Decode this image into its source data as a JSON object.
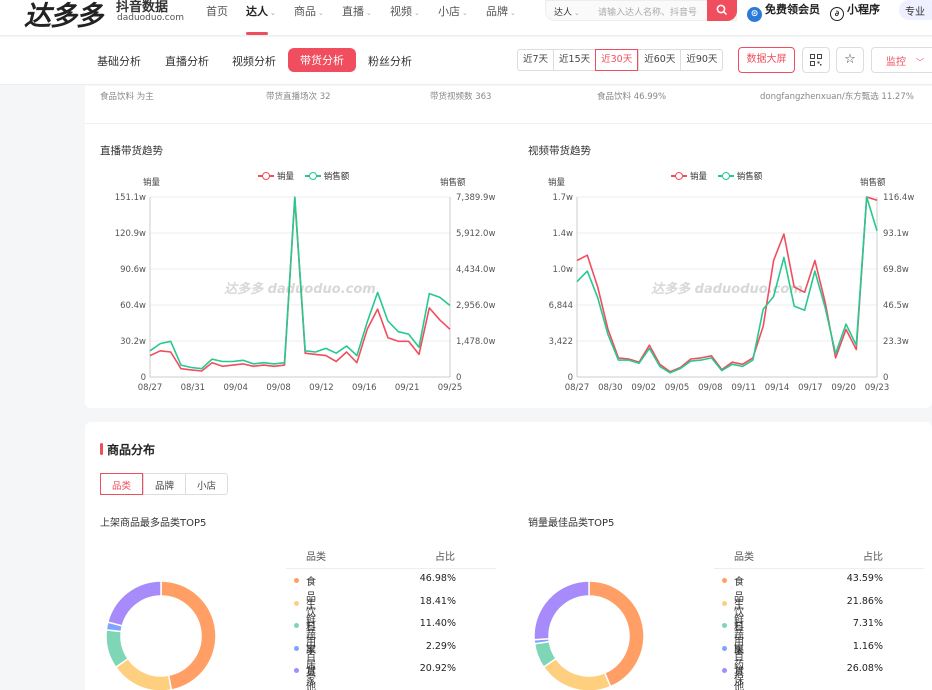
{
  "brand": {
    "logo": "达多多",
    "name": "抖音数据",
    "domain": "daduoduo.com"
  },
  "nav": [
    "首页",
    "达人",
    "商品",
    "直播",
    "视频",
    "小店",
    "品牌"
  ],
  "search": {
    "type": "达人",
    "placeholder": "请输入达人名称、抖音号"
  },
  "header_right": {
    "vip": "免费领会员",
    "mini": "小程序",
    "pro": "专业"
  },
  "tabs": [
    "基础分析",
    "直播分析",
    "视频分析",
    "带货分析",
    "粉丝分析"
  ],
  "active_tab": "带货分析",
  "ranges": [
    "近7天",
    "近15天",
    "近30天",
    "近60天",
    "近90天"
  ],
  "active_range": "近30天",
  "big_screen": "数据大屏",
  "monitor": "监控",
  "info_row": [
    "食品饮料 为主",
    "带货直播场次 32",
    "带货视频数 363",
    "食品饮料 46.99%",
    "dongfangzhenxuan/东方甄选 11.27%"
  ],
  "charts": [
    {
      "title": "直播带货趋势",
      "legend": [
        "销量",
        "销售额"
      ],
      "left_axis_name": "销量",
      "right_axis_name": "销售额",
      "left_ticks": [
        "0",
        "30.2w",
        "60.4w",
        "90.6w",
        "120.9w",
        "151.1w"
      ],
      "right_ticks": [
        "0",
        "1,478.0w",
        "2,956.0w",
        "4,434.0w",
        "5,912.0w",
        "7,389.9w"
      ],
      "x_ticks": [
        "08/27",
        "08/31",
        "09/04",
        "09/08",
        "09/12",
        "09/16",
        "09/21",
        "09/25"
      ]
    },
    {
      "title": "视频带货趋势",
      "legend": [
        "销量",
        "销售额"
      ],
      "left_axis_name": "销量",
      "right_axis_name": "销售额",
      "left_ticks": [
        "0",
        "3,422",
        "6,844",
        "1.0w",
        "1.4w",
        "1.7w"
      ],
      "right_ticks": [
        "0",
        "23.3w",
        "46.5w",
        "69.8w",
        "93.1w",
        "116.4w"
      ],
      "x_ticks": [
        "08/27",
        "08/30",
        "09/02",
        "09/05",
        "09/08",
        "09/11",
        "09/14",
        "09/17",
        "09/20",
        "09/23"
      ]
    }
  ],
  "chart_data": [
    {
      "type": "line",
      "title": "直播带货趋势",
      "xlabel": "",
      "ylabel": "销量",
      "y2label": "销售额",
      "x": [
        "08/27",
        "08/28",
        "08/29",
        "08/30",
        "08/31",
        "09/01",
        "09/02",
        "09/03",
        "09/04",
        "09/05",
        "09/06",
        "09/07",
        "09/08",
        "09/09",
        "09/10",
        "09/11",
        "09/12",
        "09/13",
        "09/14",
        "09/15",
        "09/16",
        "09/17",
        "09/18",
        "09/19",
        "09/20",
        "09/21",
        "09/22",
        "09/23",
        "09/24",
        "09/25"
      ],
      "ylim": [
        0,
        151.1
      ],
      "y2lim": [
        0,
        7389.9
      ],
      "series": [
        {
          "name": "销量",
          "axis": "left",
          "unit": "w",
          "values": [
            18,
            22,
            21,
            7,
            6,
            5,
            12,
            9,
            10,
            11,
            9,
            10,
            9,
            10,
            150,
            20,
            19,
            18,
            13,
            21,
            12,
            40,
            57,
            33,
            30,
            30,
            19,
            58,
            48,
            40
          ]
        },
        {
          "name": "销售额",
          "axis": "left_scaled",
          "unit": "w",
          "values": [
            22,
            28,
            30,
            10,
            8,
            7,
            15,
            13,
            13,
            14,
            11,
            12,
            11,
            12,
            151,
            22,
            21,
            24,
            20,
            26,
            18,
            46,
            71,
            47,
            38,
            36,
            25,
            70,
            67,
            60
          ]
        }
      ]
    },
    {
      "type": "line",
      "title": "视频带货趋势",
      "xlabel": "",
      "ylabel": "销量",
      "y2label": "销售额",
      "x": [
        "08/27",
        "08/28",
        "08/29",
        "08/30",
        "08/31",
        "09/01",
        "09/02",
        "09/03",
        "09/04",
        "09/05",
        "09/06",
        "09/07",
        "09/08",
        "09/09",
        "09/10",
        "09/11",
        "09/12",
        "09/13",
        "09/14",
        "09/15",
        "09/16",
        "09/17",
        "09/18",
        "09/19",
        "09/20",
        "09/21",
        "09/22",
        "09/23",
        "09/24",
        "09/25"
      ],
      "ylim": [
        0,
        1.7
      ],
      "y2lim": [
        0,
        116.4
      ],
      "series": [
        {
          "name": "销量",
          "axis": "left",
          "unit": "w",
          "values": [
            1.1,
            1.15,
            0.85,
            0.45,
            0.18,
            0.17,
            0.14,
            0.3,
            0.12,
            0.05,
            0.09,
            0.17,
            0.18,
            0.2,
            0.07,
            0.14,
            0.12,
            0.18,
            0.48,
            1.1,
            1.35,
            0.85,
            0.8,
            1.1,
            0.7,
            0.18,
            0.45,
            0.26,
            1.7,
            1.67
          ]
        },
        {
          "name": "销售额",
          "axis": "left_scaled",
          "unit": "w",
          "values": [
            0.9,
            1.0,
            0.75,
            0.4,
            0.16,
            0.16,
            0.13,
            0.27,
            0.1,
            0.04,
            0.08,
            0.15,
            0.16,
            0.18,
            0.06,
            0.12,
            0.1,
            0.16,
            0.64,
            0.76,
            1.13,
            0.67,
            0.63,
            1.0,
            0.65,
            0.22,
            0.5,
            0.3,
            1.7,
            1.38
          ]
        }
      ]
    }
  ],
  "distribution": {
    "title": "商品分布",
    "segments": [
      "品类",
      "品牌",
      "小店"
    ],
    "active_segment": "品类",
    "panels": [
      {
        "title": "上架商品最多品类TOP5",
        "col_category": "品类",
        "col_ratio": "占比",
        "rows": [
          {
            "name": "食品饮料",
            "ratio": "46.98%",
            "value": 46.98,
            "color": "#ff9f66"
          },
          {
            "name": "生鲜蔬果",
            "ratio": "18.41%",
            "value": 18.41,
            "color": "#ffcf80"
          },
          {
            "name": "日用百货",
            "ratio": "11.40%",
            "value": 11.4,
            "color": "#7fd6b7"
          },
          {
            "name": "家居家纺",
            "ratio": "2.29%",
            "value": 2.29,
            "color": "#7fa4ff"
          },
          {
            "name": "其他",
            "ratio": "20.92%",
            "value": 20.92,
            "color": "#a78bfa"
          }
        ]
      },
      {
        "title": "销量最佳品类TOP5",
        "col_category": "品类",
        "col_ratio": "占比",
        "rows": [
          {
            "name": "食品饮料",
            "ratio": "43.59%",
            "value": 43.59,
            "color": "#ff9f66"
          },
          {
            "name": "生鲜蔬果",
            "ratio": "21.86%",
            "value": 21.86,
            "color": "#ffcf80"
          },
          {
            "name": "日用百货",
            "ratio": "7.31%",
            "value": 7.31,
            "color": "#7fd6b7"
          },
          {
            "name": "医药保健",
            "ratio": "1.16%",
            "value": 1.16,
            "color": "#7fa4ff"
          },
          {
            "name": "其他",
            "ratio": "26.08%",
            "value": 26.08,
            "color": "#a78bfa"
          }
        ]
      }
    ]
  },
  "colors": {
    "accent": "#f04e5e",
    "sales": "#f04e5e",
    "revenue": "#26c98f"
  }
}
